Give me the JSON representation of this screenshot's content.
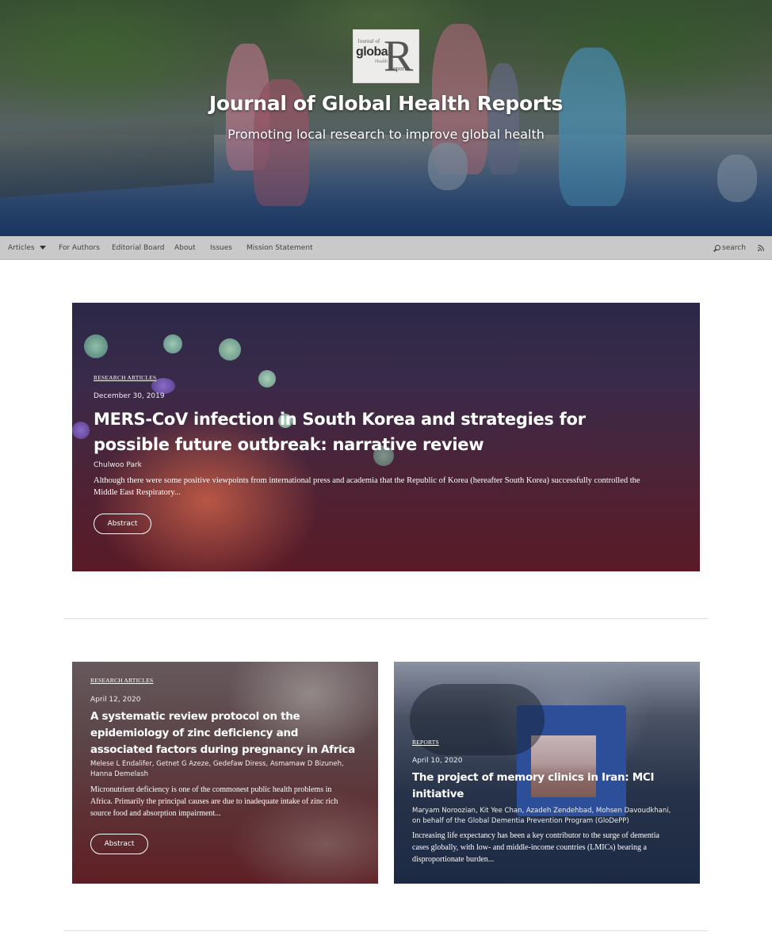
{
  "hero": {
    "logo": {
      "line1": "Journal of",
      "line2": "global",
      "line3": "Health",
      "big_letter": "R",
      "line4": "eports"
    },
    "title": "Journal of Global Health Reports",
    "subtitle": "Promoting local research to improve global health"
  },
  "nav": {
    "items": [
      "Articles",
      "For Authors",
      "Editorial Board",
      "About",
      "Issues",
      "Mission Statement"
    ],
    "search_label": "search",
    "icons": [
      "chevron-down-icon",
      "search-icon",
      "rss-icon"
    ]
  },
  "featured": {
    "section": "RESEARCH ARTICLES",
    "date": "December 30, 2019",
    "title": "MERS-CoV infection in South Korea and strategies for possible future outbreak: narrative review",
    "authors": "Chulwoo Park",
    "abstract": "Although there were some positive viewpoints from international press and academia that the Republic of Korea (hereafter South Korea) successfully controlled the Middle East Respiratory...",
    "button": "Abstract"
  },
  "articles": [
    {
      "section": "RESEARCH ARTICLES",
      "date": "April 12, 2020",
      "title": "A systematic review protocol on the epidemiology of zinc deficiency and associated factors during pregnancy in Africa",
      "authors": "Melese L Endalifer, Getnet G Azeze, Gedefaw Diress, Asmamaw D Bizuneh, Hanna Demelash",
      "abstract": "Micronutrient deficiency is one of the commonest public health problems in Africa. Primarily the principal causes are due to inadequate intake of zinc rich source food and absorption impairment...",
      "button": "Abstract"
    },
    {
      "section": "REPORTS",
      "date": "April 10, 2020",
      "title": "The project of memory clinics in Iran: MCI initiative",
      "authors": "Maryam Noroozian, Kit Yee Chan, Azadeh Zendehbad, Mohsen Davoudkhani, on behalf of the Global Dementia Prevention Program (GloDePP)",
      "abstract": "Increasing life expectancy has been a key contributor to the surge of dementia cases globally, with low- and middle-income countries (LMICs) bearing a disproportionate burden..."
    }
  ]
}
